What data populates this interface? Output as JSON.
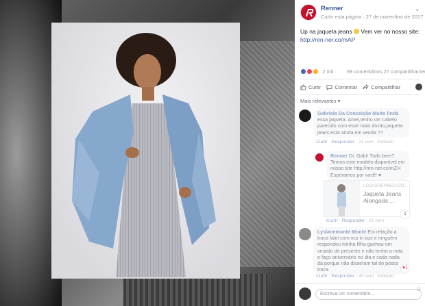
{
  "post": {
    "page_name": "Renner",
    "meta": "Curtir esta página · 27 de novembro de 2017 ·",
    "text": "Up na jaqueta jeans",
    "text_after": " Vem ver no nosso site:",
    "link": "http://ren-ner.co/mAP",
    "reaction_count": "2 mil",
    "stats": "89 comentários  27 compartilhamentos",
    "actions": [
      "Curtir",
      "Comentar",
      "Compartilhar"
    ],
    "relevance": "Mais relevantes ▾"
  },
  "comments": [
    {
      "author": "Gabriela Da Conceição Muito linda",
      "text": " essa jaqueta. Amei,tenho um cabelo parecido com esse mais docito,jaqueta jeans esta ainda em venda ??",
      "meta_a": "Curtir",
      "meta_b": "Responder",
      "meta_c": "· 21 sem · Editado"
    },
    {
      "author": "Renner",
      "text": " Oi, Gabi! Tudo bem? Temos este modelo disponível em nosso site http://ren-ner.co/mZH Esperamos por você! ♥",
      "link_card": {
        "domain": "LOJASRENNER.CO...",
        "title": "Jaqueta Jeans Alongada ..."
      },
      "meta_a": "Curtir",
      "meta_b": "Responder",
      "meta_c": "· 21 sem",
      "badge": "1"
    },
    {
      "author": "Lyslanemonte Monte",
      "text": " Em relação a troca falei com vcs in box e ninguém respondeu minha filha ganhou um vestido de presente e não tenho a nota e faço aniversário no dia e cada nada dá porque não disseram tal do posso troca",
      "meta_a": "Curtir",
      "meta_b": "Responder",
      "meta_c": "· 40 sem · Editado",
      "badge": "1"
    }
  ],
  "composer": {
    "placeholder": "Escreva um comentário..."
  },
  "colors": {
    "link": "#385898",
    "brand_red": "#c8102e"
  }
}
